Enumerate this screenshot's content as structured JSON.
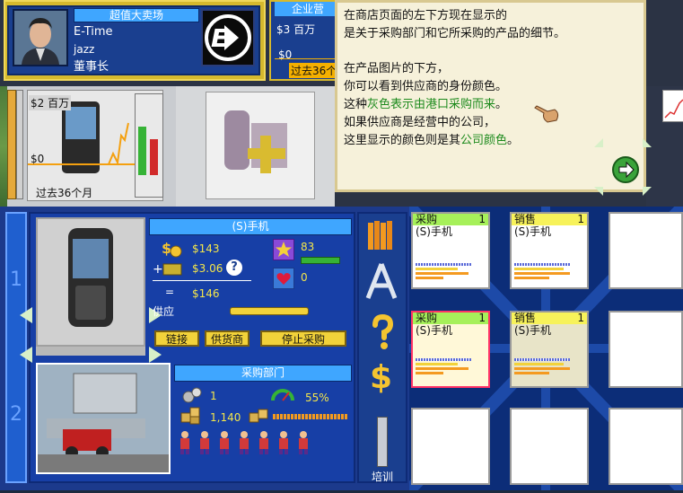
{
  "top": {
    "store_title": "超值大卖场",
    "company": "E-Time",
    "player": "jazz",
    "role": "董事长",
    "corp_title": "企业营",
    "corp_amount": "$3 百万",
    "corp_zero": "$0",
    "corp_period": "过去36个"
  },
  "tooltip": {
    "l1": "在商店页面的左下方现在显示的",
    "l2": "是关于采购部门和它所采购的产品的细节。",
    "l3": "在产品图片的下方，",
    "l4": "你可以看到供应商的身份颜色。",
    "l5a": "这种",
    "l5b": "灰色表示由港口采购而来",
    "l5c": "。",
    "l6": "如果供应商是经营中的公司，",
    "l7a": "这里显示的颜色则是其",
    "l7b": "公司颜色",
    "l7c": "。"
  },
  "chart": {
    "top_label": "$2 百万",
    "zero_label": "$0",
    "period": "过去36个月"
  },
  "product": {
    "name": "(S)手机",
    "cost": "$143",
    "extra": "$3.06",
    "total": "$146",
    "eq": "=",
    "rating": "83",
    "love": "0",
    "supply_label": "供应",
    "help_glyph": "?"
  },
  "buttons": {
    "link": "链接",
    "supplier": "供货商",
    "stop": "停止采购"
  },
  "dept": {
    "title": "采购部门",
    "level": "1",
    "percent": "55%",
    "stock": "1,140"
  },
  "tools": {
    "training": "培训"
  },
  "rails": {
    "tab1": "1",
    "tab2": "2"
  },
  "cards": [
    {
      "type": "采购",
      "n": "1",
      "sub": "(S)手机",
      "head": "green"
    },
    {
      "type": "销售",
      "n": "1",
      "sub": "(S)手机",
      "head": "yellow"
    },
    {
      "type": "采购",
      "n": "1",
      "sub": "(S)手机",
      "head": "green"
    },
    {
      "type": "销售",
      "n": "1",
      "sub": "(S)手机",
      "head": "yellow"
    }
  ]
}
